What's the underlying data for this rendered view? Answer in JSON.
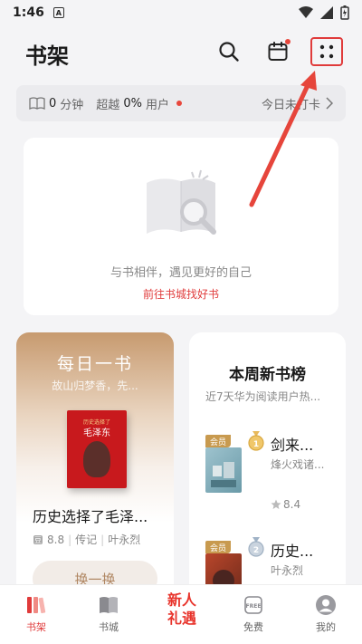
{
  "status_bar": {
    "time": "1:46",
    "app_badge": "A"
  },
  "header": {
    "title": "书架"
  },
  "stats": {
    "minutes_value": "0",
    "minutes_unit": "分钟",
    "beat_prefix": "超越",
    "beat_value": "0%",
    "beat_suffix": "用户",
    "checkin_text": "今日未打卡"
  },
  "empty_shelf": {
    "message": "与书相伴，遇见更好的自己",
    "link": "前往书城找好书"
  },
  "daily_book": {
    "title": "每日一书",
    "quote": "故山归梦香，先...",
    "cover_label": "历史选择了",
    "cover_title": "毛泽东",
    "book_name": "历史选择了毛泽...",
    "score": "8.8",
    "category": "传记",
    "author": "叶永烈",
    "button": "换一换"
  },
  "weekly": {
    "title": "本周新书榜",
    "subtitle": "近7天华为阅读用户热...",
    "items": [
      {
        "rank": "1",
        "name": "剑来...",
        "author": "烽火戏诸...",
        "rating": "8.4",
        "vip": "会员"
      },
      {
        "rank": "2",
        "name": "历史...",
        "author": "叶永烈",
        "vip": "会员"
      }
    ]
  },
  "tabbar": {
    "tabs": [
      {
        "label": "书架"
      },
      {
        "label": "书城"
      },
      {
        "label": ""
      },
      {
        "label": "免费"
      },
      {
        "label": "我的"
      }
    ],
    "promo_line1": "新人",
    "promo_line2": "礼遇",
    "free_icon_text": "FREE"
  },
  "colors": {
    "accent": "#e03b3b",
    "background": "#f4f4f6",
    "gold": "#c89a4f"
  }
}
